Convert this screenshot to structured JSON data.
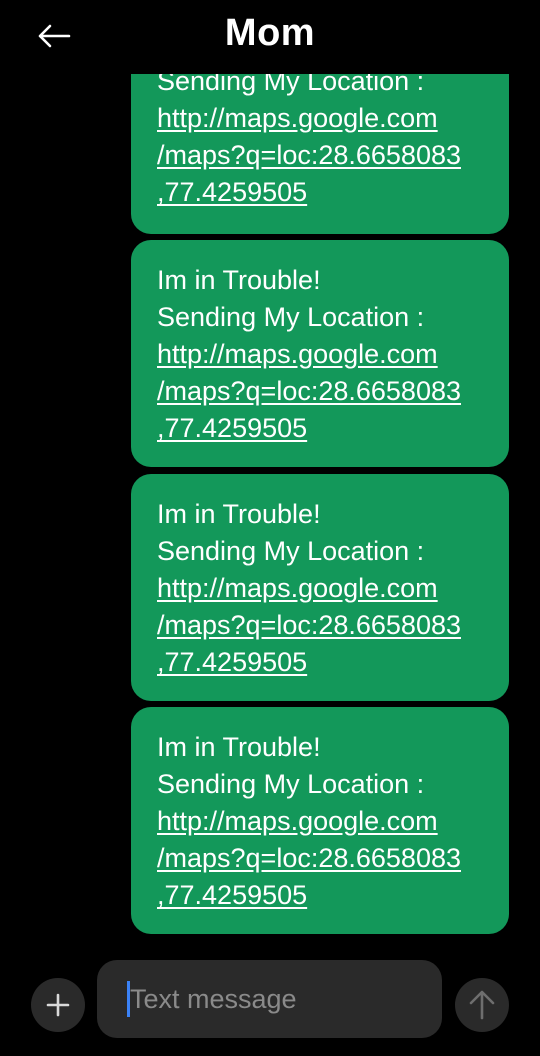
{
  "header": {
    "title": "Mom",
    "back_icon": "arrow-left-icon"
  },
  "messages": [
    {
      "lines": [
        "Sending My Location :"
      ],
      "link_lines": [
        "http://maps.google.com",
        "/maps?q=loc:28.6658083",
        ",77.4259505"
      ],
      "partially_visible": true
    },
    {
      "lines": [
        "Im in Trouble!",
        "Sending My Location :"
      ],
      "link_lines": [
        "http://maps.google.com",
        "/maps?q=loc:28.6658083",
        ",77.4259505"
      ]
    },
    {
      "lines": [
        "Im in Trouble!",
        "Sending My Location :"
      ],
      "link_lines": [
        "http://maps.google.com",
        "/maps?q=loc:28.6658083",
        ",77.4259505"
      ]
    },
    {
      "lines": [
        "Im in Trouble!",
        "Sending My Location :"
      ],
      "link_lines": [
        "http://maps.google.com",
        "/maps?q=loc:28.6658083",
        ",77.4259505"
      ]
    }
  ],
  "composer": {
    "placeholder": "Text message",
    "value": "",
    "attach_icon": "plus-icon",
    "send_icon": "arrow-up-icon"
  },
  "colors": {
    "background": "#000000",
    "bubble": "#13985a",
    "composer_field": "#2a2a2a",
    "cursor": "#3b82f6",
    "placeholder": "#8a8a8a"
  }
}
